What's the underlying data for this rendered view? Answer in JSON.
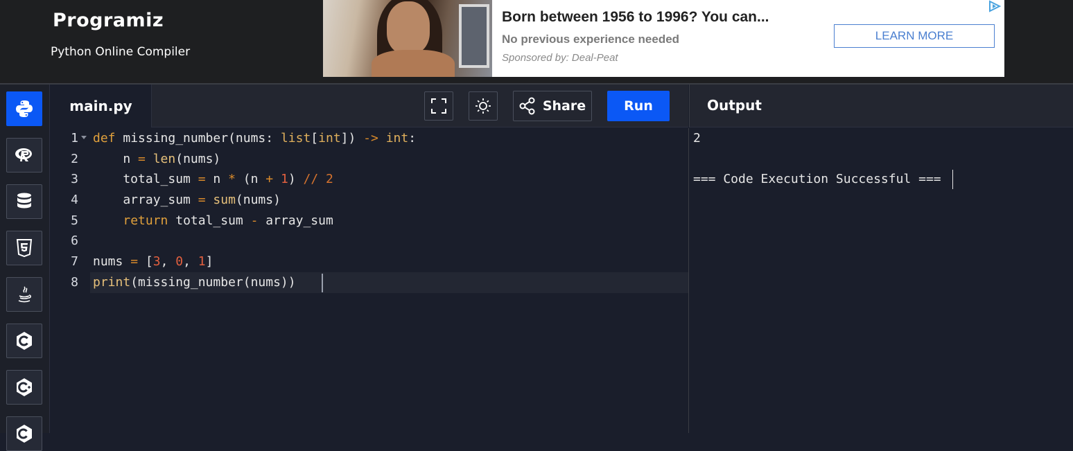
{
  "header": {
    "logo_text": "Programiz",
    "subtitle": "Python Online Compiler"
  },
  "ad": {
    "title": "Born between 1956 to 1996? You can...",
    "subtitle": "No previous experience needed",
    "sponsor": "Sponsored by: Deal-Peat",
    "cta": "LEARN MORE",
    "choices_icon": "adchoices-icon"
  },
  "sidebar": {
    "languages": [
      {
        "name": "python",
        "icon": "python-icon",
        "active": true
      },
      {
        "name": "r",
        "icon": "r-icon"
      },
      {
        "name": "sql",
        "icon": "database-icon"
      },
      {
        "name": "html",
        "icon": "html5-icon"
      },
      {
        "name": "java",
        "icon": "java-icon"
      },
      {
        "name": "c",
        "icon": "c-icon"
      },
      {
        "name": "cpp",
        "icon": "cpp-icon"
      },
      {
        "name": "csharp",
        "icon": "csharp-icon"
      }
    ]
  },
  "editor": {
    "tab": "main.py",
    "toolbar": {
      "fullscreen_icon": "fullscreen-icon",
      "theme_icon": "sun-icon",
      "share_label": "Share",
      "run_label": "Run"
    },
    "line_numbers": [
      "1",
      "2",
      "3",
      "4",
      "5",
      "6",
      "7",
      "8"
    ],
    "lines": [
      "def missing_number(nums: list[int]) -> int:",
      "    n = len(nums)",
      "    total_sum = n * (n + 1) // 2",
      "    array_sum = sum(nums)",
      "    return total_sum - array_sum",
      "",
      "nums = [3, 0, 1]",
      "print(missing_number(nums))"
    ]
  },
  "output": {
    "title": "Output",
    "lines": [
      "2",
      "",
      "=== Code Execution Successful ==="
    ]
  },
  "colors": {
    "accent": "#0b58f5",
    "background": "#1a1e2b",
    "header_bg": "#1e1f21",
    "keyword": "#e0a03c",
    "number": "#e2603f"
  }
}
